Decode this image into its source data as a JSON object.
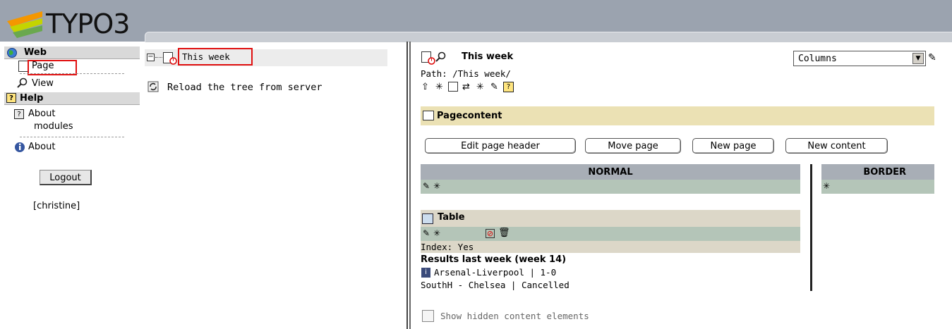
{
  "header": {
    "logo_text": "TYPO3"
  },
  "menu": {
    "web_label": "Web",
    "page_label": "Page",
    "view_label": "View",
    "help_label": "Help",
    "about_modules_line1": "About",
    "about_modules_line2": "modules",
    "about_label": "About",
    "logout_label": "Logout",
    "username": "[christine]"
  },
  "tree": {
    "root_label": "This week",
    "reload_label": "Reload the tree from server"
  },
  "content": {
    "page_title": "This week",
    "path": "Path: /This week/",
    "view_select": "Columns",
    "section_title": "Pagecontent",
    "buttons": [
      "Edit page header",
      "Move page",
      "New page",
      "New content"
    ],
    "col_normal": "NORMAL",
    "col_border": "BORDER",
    "element": {
      "type_label": "Table",
      "index": "Index: Yes",
      "heading": "Results last week (week 14)",
      "line1": "Arsenal-Liverpool | 1-0",
      "line2": "SouthH - Chelsea | Cancelled"
    },
    "show_hidden_label": "Show hidden content elements"
  }
}
